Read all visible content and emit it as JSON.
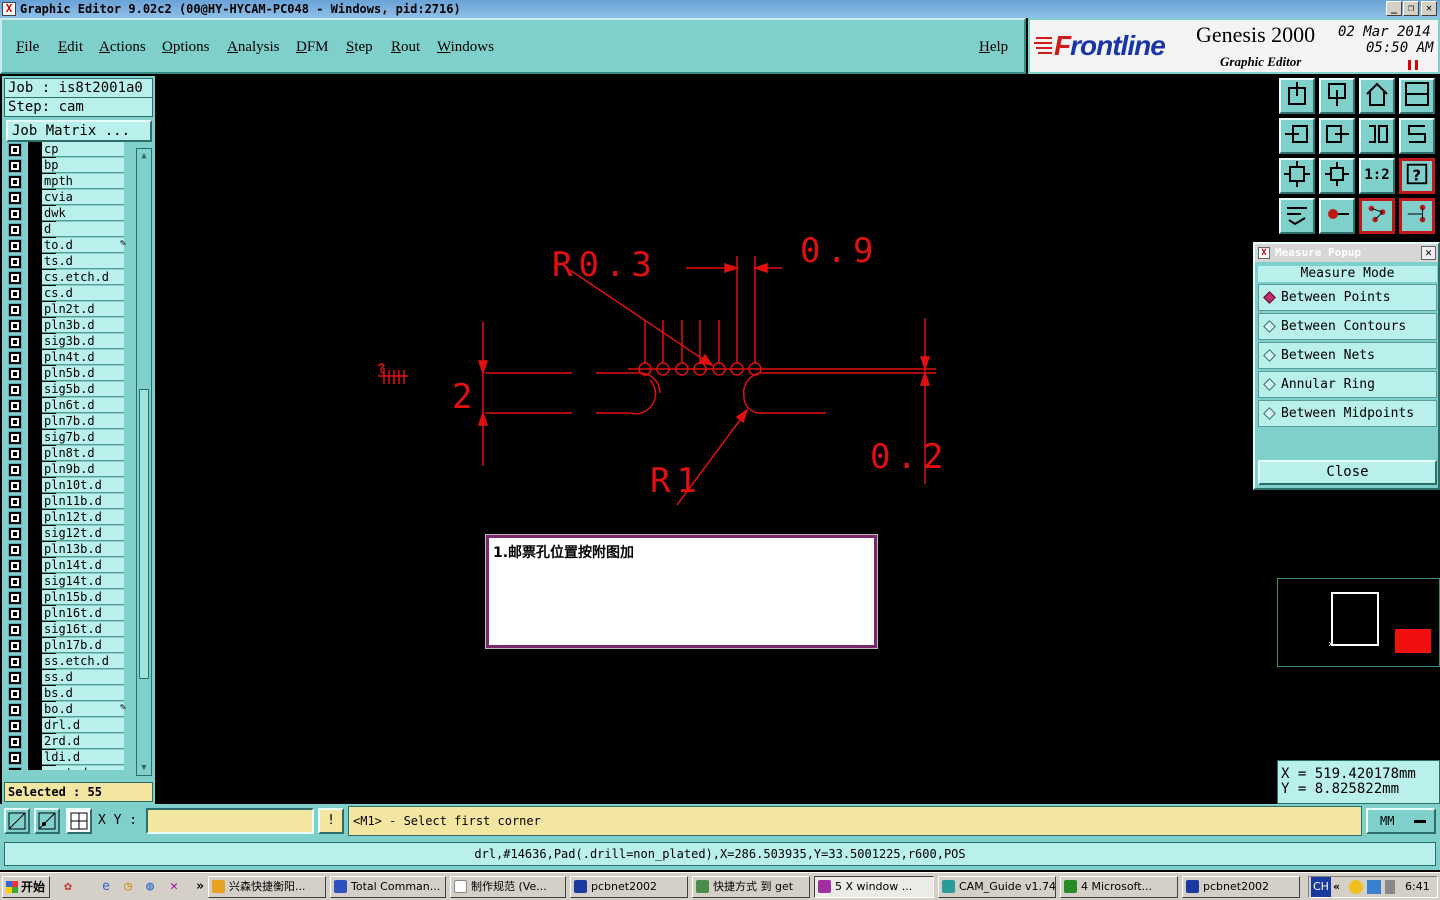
{
  "window": {
    "title": "Graphic Editor 9.02c2 (00@HY-HYCAM-PC048 - Windows, pid:2716)",
    "app_icon": "x-icon"
  },
  "menubar": {
    "items": [
      "File",
      "Edit",
      "Actions",
      "Options",
      "Analysis",
      "DFM",
      "Step",
      "Rout",
      "Windows"
    ],
    "help": "Help"
  },
  "brand": {
    "logo": "Frontline",
    "product": "Genesis 2000",
    "subtitle": "Graphic Editor",
    "date": "02 Mar 2014",
    "time": "05:50 AM"
  },
  "leftpanel": {
    "job": "Job : is8t2001a0",
    "step": "Step: cam",
    "job_matrix": "Job Matrix ...",
    "layers": [
      {
        "name": "cp",
        "mark": ""
      },
      {
        "name": "bp",
        "mark": ""
      },
      {
        "name": "mpth",
        "mark": ""
      },
      {
        "name": "cvia",
        "mark": ""
      },
      {
        "name": "dwk",
        "mark": ""
      },
      {
        "name": "d",
        "mark": ""
      },
      {
        "name": "to.d",
        "mark": "✎"
      },
      {
        "name": "ts.d",
        "mark": ""
      },
      {
        "name": "cs.etch.d",
        "mark": ""
      },
      {
        "name": "cs.d",
        "mark": ""
      },
      {
        "name": "pln2t.d",
        "mark": ""
      },
      {
        "name": "pln3b.d",
        "mark": ""
      },
      {
        "name": "sig3b.d",
        "mark": ""
      },
      {
        "name": "pln4t.d",
        "mark": ""
      },
      {
        "name": "pln5b.d",
        "mark": ""
      },
      {
        "name": "sig5b.d",
        "mark": ""
      },
      {
        "name": "pln6t.d",
        "mark": ""
      },
      {
        "name": "pln7b.d",
        "mark": ""
      },
      {
        "name": "sig7b.d",
        "mark": ""
      },
      {
        "name": "pln8t.d",
        "mark": ""
      },
      {
        "name": "pln9b.d",
        "mark": ""
      },
      {
        "name": "pln10t.d",
        "mark": ""
      },
      {
        "name": "pln11b.d",
        "mark": ""
      },
      {
        "name": "pln12t.d",
        "mark": ""
      },
      {
        "name": "sig12t.d",
        "mark": ""
      },
      {
        "name": "pln13b.d",
        "mark": ""
      },
      {
        "name": "pln14t.d",
        "mark": ""
      },
      {
        "name": "sig14t.d",
        "mark": ""
      },
      {
        "name": "pln15b.d",
        "mark": ""
      },
      {
        "name": "pln16t.d",
        "mark": ""
      },
      {
        "name": "sig16t.d",
        "mark": ""
      },
      {
        "name": "pln17b.d",
        "mark": ""
      },
      {
        "name": "ss.etch.d",
        "mark": ""
      },
      {
        "name": "ss.d",
        "mark": ""
      },
      {
        "name": "bs.d",
        "mark": ""
      },
      {
        "name": "bo.d",
        "mark": "✎"
      },
      {
        "name": "drl.d",
        "mark": ""
      },
      {
        "name": "2rd.d",
        "mark": ""
      },
      {
        "name": "ldi.d",
        "mark": ""
      },
      {
        "name": "rout.d",
        "mark": ""
      }
    ],
    "selected": "Selected : 55"
  },
  "canvas": {
    "drawing_color": "#e01010",
    "dims": {
      "r03": "R0.3",
      "w09": "0.9",
      "h2": "2",
      "r1": "R1",
      "h02": "0.2"
    },
    "note": "1.邮票孔位置按附图加"
  },
  "toolbar": {
    "buttons": [
      "view-top-icon",
      "view-bottom-icon",
      "home-icon",
      "split-view-icon",
      "scroll-left-icon",
      "scroll-right-icon",
      "mirror-icon",
      "snap-icon",
      "zoom-fit-icon",
      "zoom-center-icon",
      "ratio-1-2-label",
      "help-icon",
      "tools-icon",
      "measure-icon",
      "layers-icon",
      "netlist-icon"
    ],
    "ratio_label": "1:2"
  },
  "measure_popup": {
    "title": "Measure Popup",
    "mode_label": "Measure Mode",
    "options": [
      "Between Points",
      "Between Contours",
      "Between Nets",
      "Annular Ring",
      "Between Midpoints"
    ],
    "selected_option": "Between Points",
    "close": "Close"
  },
  "coords": {
    "x": "X = 519.420178mm",
    "y": "Y = 8.825822mm"
  },
  "command": {
    "xy_label": "X Y :",
    "xy_value": "",
    "alert": "!",
    "prompt": "<M1> - Select first corner",
    "units": "MM"
  },
  "status": "drl,#14636,Pad(.drill=non_plated),X=286.503935,Y=33.5001225,r600,POS",
  "taskbar": {
    "start": "开始",
    "quick_launch_more": "»",
    "tasks": [
      {
        "label": "兴森快捷衡阳...",
        "active": false
      },
      {
        "label": "Total Comman...",
        "active": false
      },
      {
        "label": "制作规范 (Ve...",
        "active": false
      },
      {
        "label": "pcbnet2002",
        "active": false
      },
      {
        "label": "快捷方式 到 get",
        "active": false
      },
      {
        "label": "5 X window ...",
        "active": true
      },
      {
        "label": "CAM_Guide v1.74",
        "active": false
      },
      {
        "label": "4 Microsoft...",
        "active": false
      },
      {
        "label": "pcbnet2002",
        "active": false
      }
    ],
    "tray_lang": "CH",
    "tray_more": "«",
    "clock": "6:41"
  }
}
